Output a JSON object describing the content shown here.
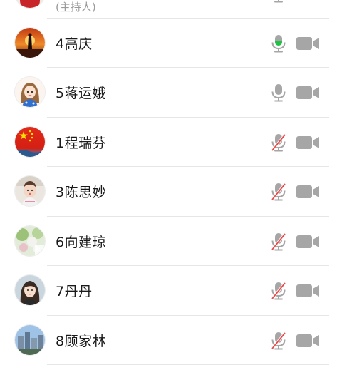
{
  "participants": [
    {
      "name": "",
      "role": "(主持人)",
      "mic": "on",
      "camera": "off",
      "avatar": "avatar-red-icon"
    },
    {
      "name": "4高庆",
      "mic": "speaking",
      "camera": "off",
      "avatar": "sunset-silhouette-avatar-icon"
    },
    {
      "name": "5蒋运娥",
      "mic": "on",
      "camera": "off",
      "avatar": "cartoon-girl-avatar-icon"
    },
    {
      "name": "1程瑞芬",
      "mic": "muted",
      "camera": "off",
      "avatar": "chinese-flag-avatar-icon"
    },
    {
      "name": "3陈思妙",
      "mic": "muted",
      "camera": "off",
      "avatar": "child-photo-avatar-icon"
    },
    {
      "name": "6向建琼",
      "mic": "muted",
      "camera": "off",
      "avatar": "garden-photo-avatar-icon"
    },
    {
      "name": "7丹丹",
      "mic": "muted",
      "camera": "off",
      "avatar": "woman-portrait-avatar-icon"
    },
    {
      "name": "8顾家林",
      "mic": "muted",
      "camera": "off",
      "avatar": "city-view-avatar-icon"
    }
  ],
  "colors": {
    "icon_gray": "#a6a6a6",
    "speaking_green": "#1ec245",
    "muted_red": "#e94b4b",
    "divider": "#e6e6e6"
  }
}
